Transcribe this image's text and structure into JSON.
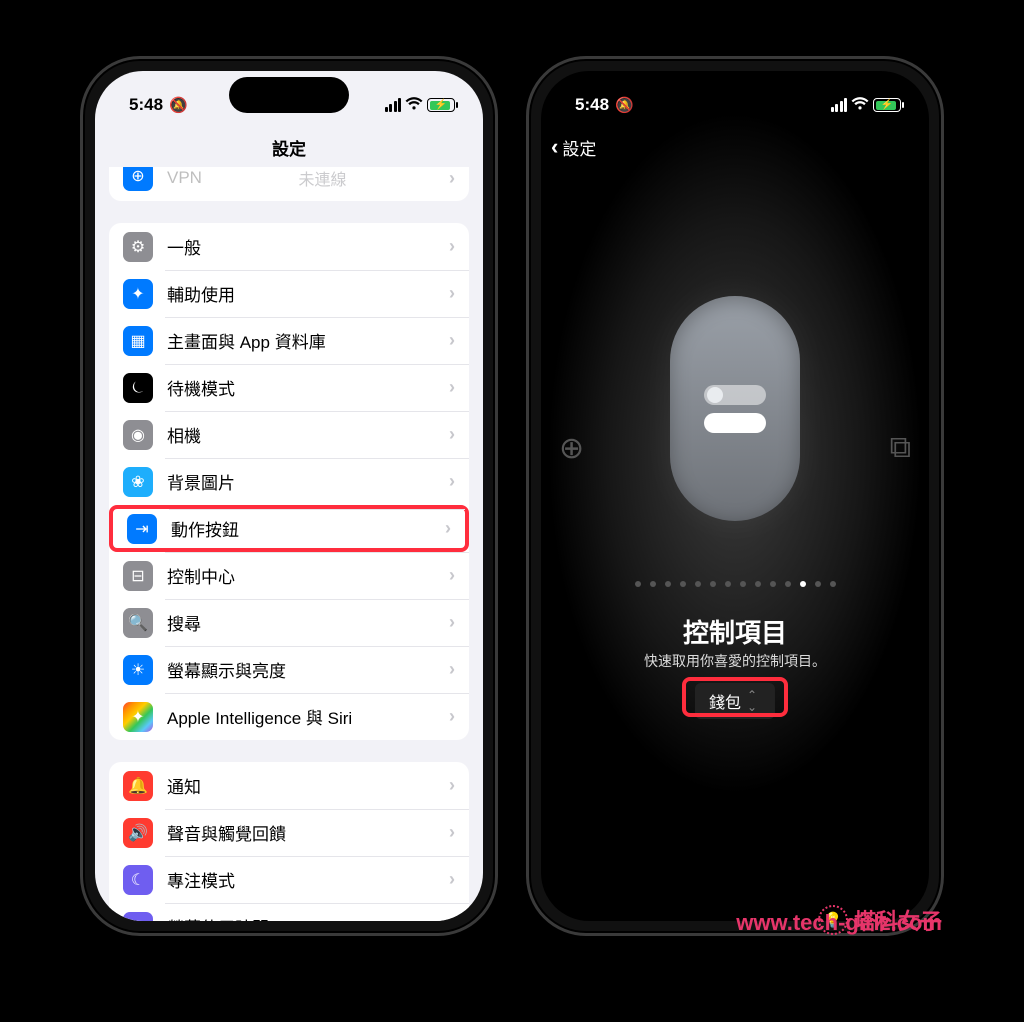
{
  "status": {
    "time": "5:48"
  },
  "left": {
    "title": "設定",
    "partial": {
      "label": "VPN",
      "value": "未連線"
    },
    "section1": [
      {
        "name": "general",
        "label": "一般",
        "iconClass": "ic-gray",
        "glyph": "⚙"
      },
      {
        "name": "accessibility",
        "label": "輔助使用",
        "iconClass": "ic-blue",
        "glyph": "✦"
      },
      {
        "name": "home-screen",
        "label": "主畫面與 App 資料庫",
        "iconClass": "ic-blue",
        "glyph": "▦"
      },
      {
        "name": "standby",
        "label": "待機模式",
        "iconClass": "ic-black",
        "glyph": "⏾"
      },
      {
        "name": "camera",
        "label": "相機",
        "iconClass": "ic-gray",
        "glyph": "◉"
      },
      {
        "name": "wallpaper",
        "label": "背景圖片",
        "iconClass": "ic-cyan",
        "glyph": "❀"
      },
      {
        "name": "action-button",
        "label": "動作按鈕",
        "iconClass": "ic-blue",
        "glyph": "⇥",
        "highlight": true
      },
      {
        "name": "control-center",
        "label": "控制中心",
        "iconClass": "ic-gray",
        "glyph": "⊟"
      },
      {
        "name": "search",
        "label": "搜尋",
        "iconClass": "ic-gray",
        "glyph": "🔍"
      },
      {
        "name": "display",
        "label": "螢幕顯示與亮度",
        "iconClass": "ic-blue",
        "glyph": "☀"
      },
      {
        "name": "siri",
        "label": "Apple Intelligence 與 Siri",
        "iconClass": "ic-rainbow",
        "glyph": "✦"
      }
    ],
    "section2": [
      {
        "name": "notifications",
        "label": "通知",
        "iconClass": "ic-red",
        "glyph": "🔔"
      },
      {
        "name": "sound",
        "label": "聲音與觸覺回饋",
        "iconClass": "ic-red",
        "glyph": "🔊"
      },
      {
        "name": "focus",
        "label": "專注模式",
        "iconClass": "ic-purple",
        "glyph": "☾"
      },
      {
        "name": "screentime",
        "label": "螢幕使用時間",
        "iconClass": "ic-purple",
        "glyph": "⧗"
      }
    ]
  },
  "right": {
    "back": "設定",
    "title": "控制項目",
    "subtitle": "快速取用你喜愛的控制項目。",
    "selected": "錢包",
    "page_count": 14,
    "active_page_index": 11
  },
  "watermark": {
    "text": "塔科女子",
    "url": "www.tech-girlz.com"
  }
}
